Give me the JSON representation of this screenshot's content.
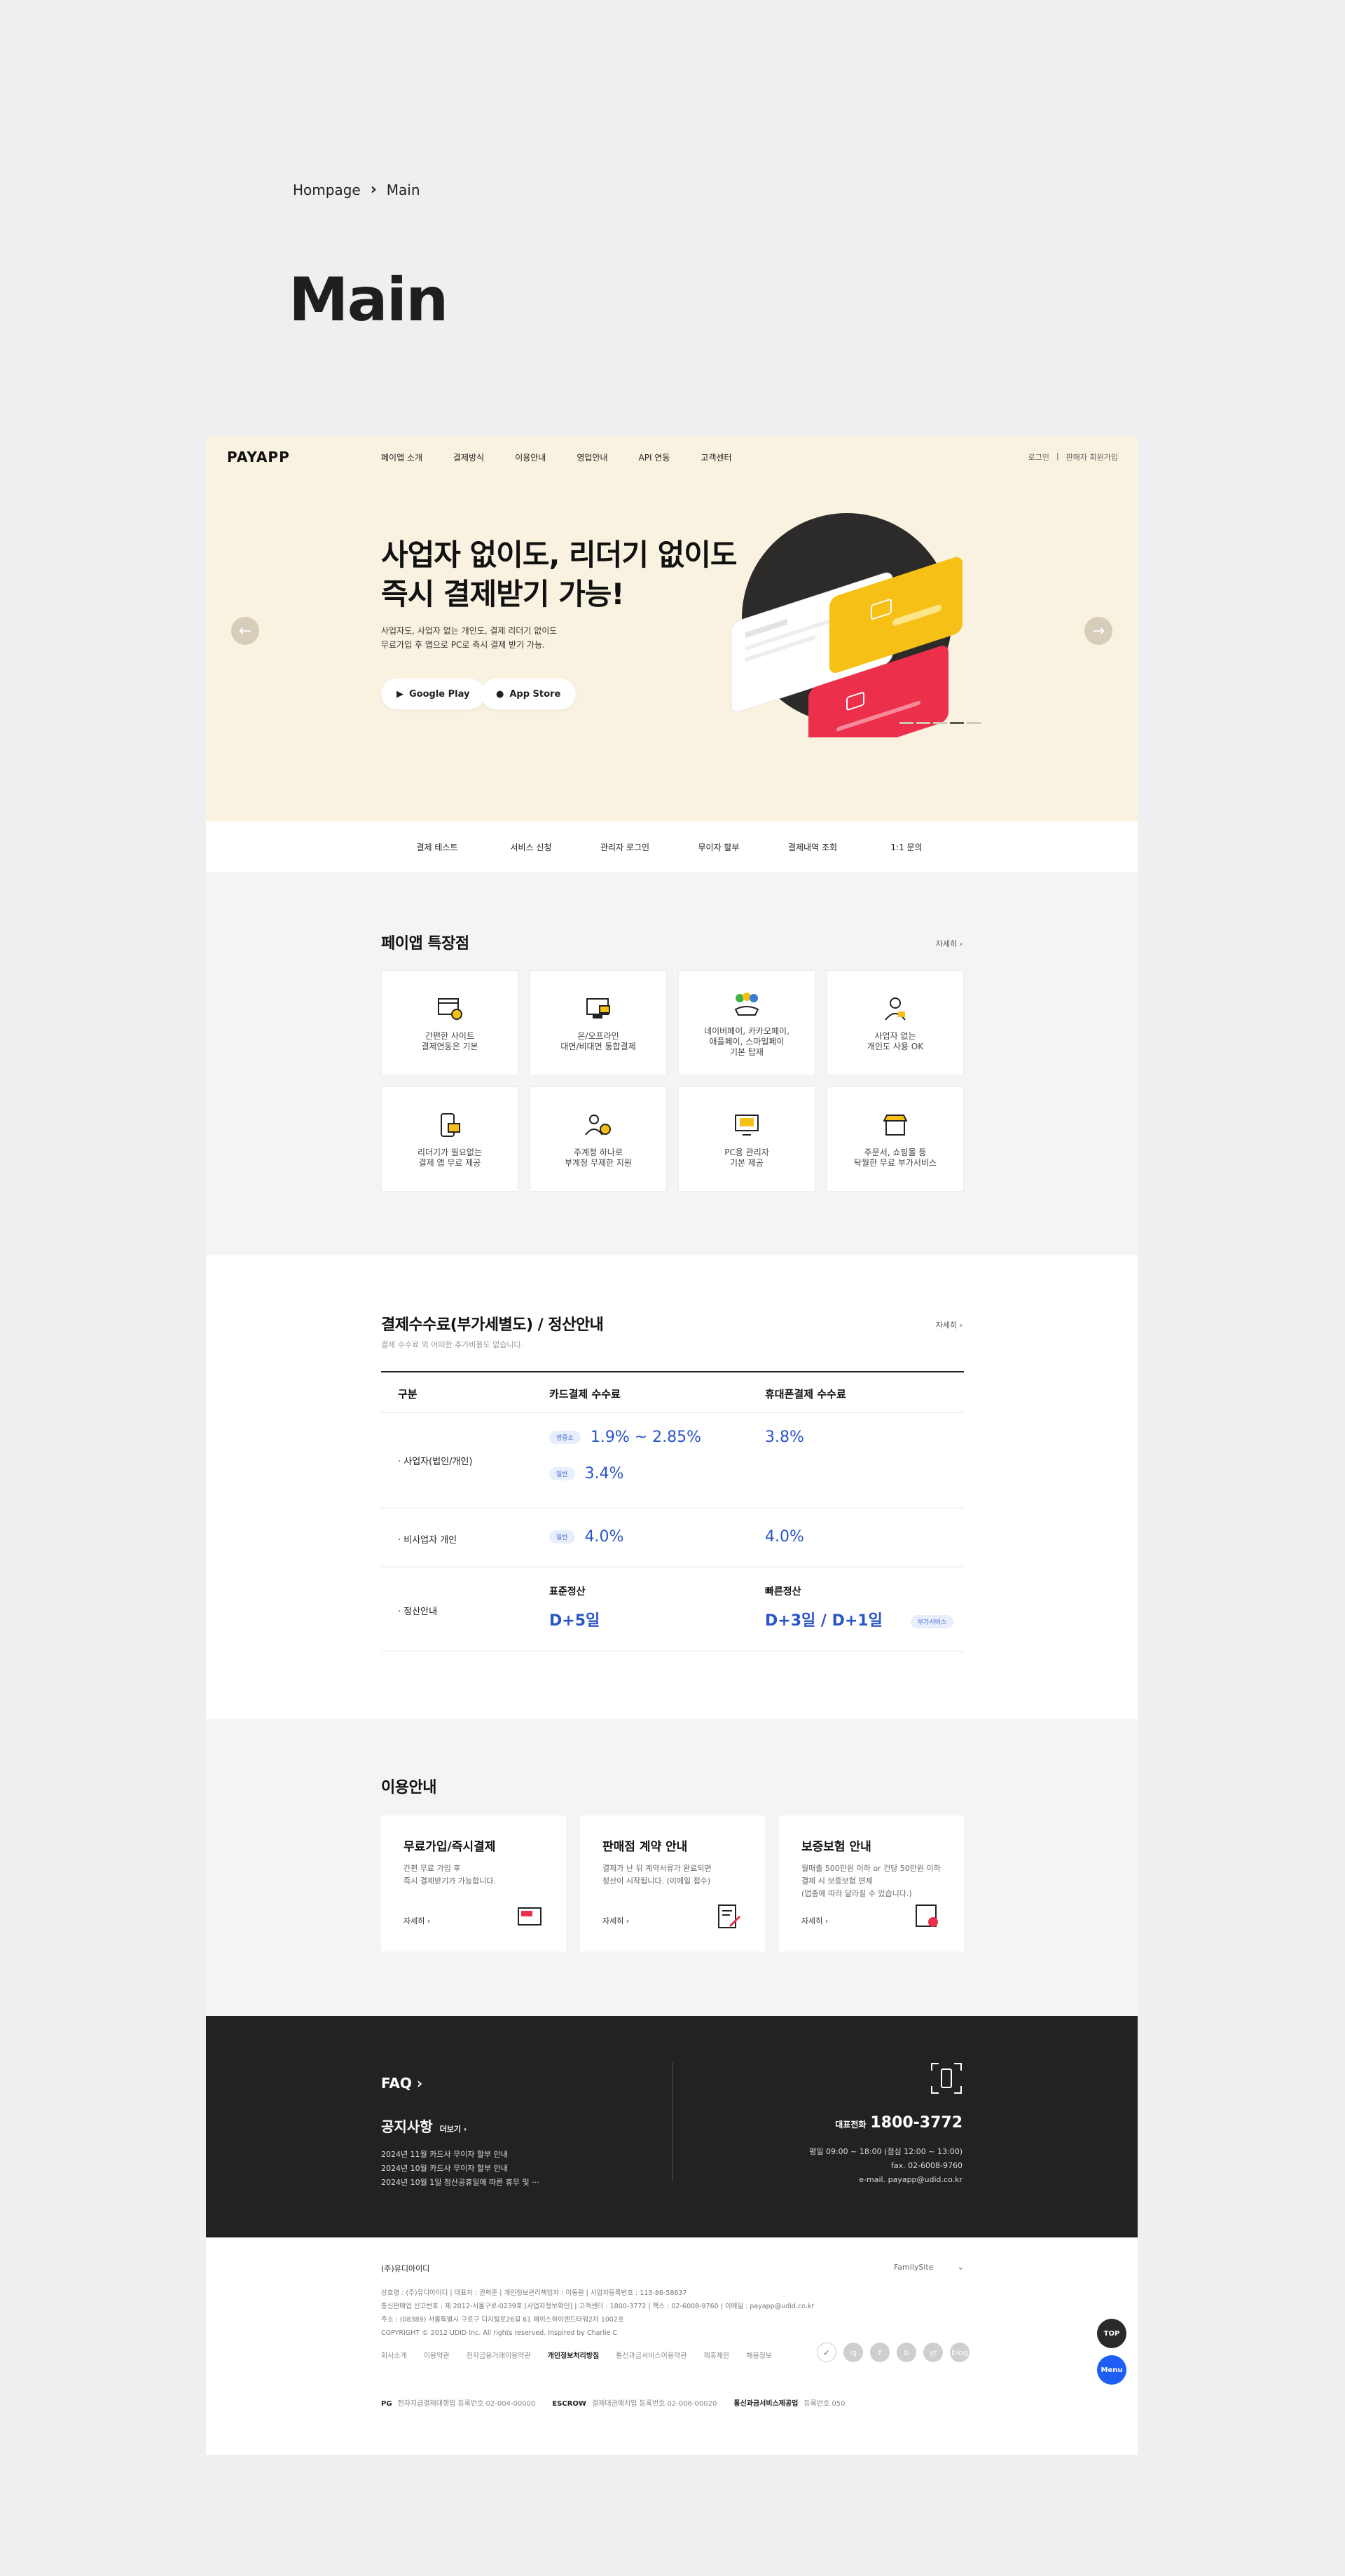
{
  "breadcrumb": {
    "home": "Hompage",
    "current": "Main"
  },
  "page_title": "Main",
  "nav": {
    "logo": "PAYAPP",
    "menu": [
      "페이앱 소개",
      "결제방식",
      "이용안내",
      "영업안내",
      "API 연동",
      "고객센터"
    ],
    "login": "로그인",
    "signup": "판매자 회원가입"
  },
  "hero": {
    "title_line1": "사업자 없이도, 리더기 없이도",
    "title_line2": "즉시 결제받기 가능!",
    "desc_line1": "사업자도, 사업자 없는 개인도, 결제 리더기 없이도",
    "desc_line2": "무료가입 후 앱으로 PC로 즉시 결제 받기 가능.",
    "google_play": "Google Play",
    "app_store": "App Store",
    "prev": "←",
    "next": "→"
  },
  "quick_links": [
    "결제 테스트",
    "서비스 신청",
    "관리자 로그인",
    "무이자 할부",
    "결제내역 조회",
    "1:1 문의"
  ],
  "features": {
    "title": "페이앱 특장점",
    "more": "자세히",
    "items": [
      {
        "label": "간편한 사이트\n결제연동은 기본",
        "icon": "browser-payment-icon"
      },
      {
        "label": "온/오프라인\n대면/비대면 통합결제",
        "icon": "card-terminal-icon"
      },
      {
        "label": "네이버페이, 카카오페이,\n애플페이, 스마일페이\n기본 탑재",
        "icon": "easy-pay-icon"
      },
      {
        "label": "사업자 없는\n개인도 사용 OK",
        "icon": "person-icon"
      },
      {
        "label": "리더기가 필요없는\n결제 앱 무료 제공",
        "icon": "mobile-app-icon"
      },
      {
        "label": "주계정 하나로\n부계정 무제한 지원",
        "icon": "users-check-icon"
      },
      {
        "label": "PC용 관리자\n기본 제공",
        "icon": "monitor-code-icon"
      },
      {
        "label": "주문서, 쇼핑몰 등\n탁월한 무료 부가서비스",
        "icon": "shop-icon"
      }
    ]
  },
  "fees": {
    "title": "결제수수료(부가세별도) / 정산안내",
    "subtitle": "결제 수수료 외 어떠한 추가비용도 없습니다.",
    "more": "자세히",
    "headers": [
      "구분",
      "카드결제 수수료",
      "휴대폰결제 수수료"
    ],
    "rows": {
      "business": {
        "label": "사업자(법인/개인)",
        "tag_special": "영중소",
        "card_special": "1.9% ~ 2.85%",
        "tag_general": "일반",
        "card_general": "3.4%",
        "mobile": "3.8%"
      },
      "individual": {
        "label": "비사업자 개인",
        "tag_general": "일반",
        "card": "4.0%",
        "mobile": "4.0%"
      },
      "settlement": {
        "label": "정산안내",
        "standard_title": "표준정산",
        "standard_value": "D+5일",
        "fast_title": "빠른정산",
        "fast_value": "D+3일 / D+1일",
        "fast_tag": "부가서비스"
      }
    }
  },
  "guide": {
    "title": "이용안내",
    "cards": [
      {
        "title": "무료가입/즉시결제",
        "desc": "간편 무료 가입 후\n즉시 결제받기가 가능합니다.",
        "more": "자세히",
        "icon": "free-card-icon"
      },
      {
        "title": "판매점 계약 안내",
        "desc": "결제가 난 뒤 계약서류가 완료되면\n정산이 시작됩니다. (이메일 접수)",
        "more": "자세히",
        "icon": "contract-icon"
      },
      {
        "title": "보증보험 안내",
        "desc": "월매출 500만원 이하 or 건당 50만원 이하\n결제 시 보증보험 면제\n(업종에 따라 달라질 수 있습니다.)",
        "more": "자세히",
        "icon": "certificate-icon"
      }
    ]
  },
  "dark_footer": {
    "faq": "FAQ",
    "notice": "공지사항",
    "notice_more": "더보기",
    "notices": [
      "2024년 11월 카드사 무이자 할부 안내",
      "2024년 10월 카드사 무이자 할부 안내",
      "2024년 10월 1일 정산공휴일에 따른 휴무 및 ···"
    ],
    "tel_label": "대표전화",
    "tel": "1800-3772",
    "hours": "평일 09:00 ~ 18:00 (점심 12:00 ~ 13:00)",
    "fax": "fax. 02-6008-9760",
    "email": "e-mail. payapp@udid.co.kr"
  },
  "footer": {
    "company": "(주)유디아이디",
    "family_site": "FamilySite",
    "info_lines": [
      "상호명 : (주)유디아이디   |   대표자 : 권혁준   |   개인정보관리책임자 : 이동원   |   사업자등록번호 : 113-86-58637",
      "통신판매업 신고번호 : 제 2012-서울구로-0239호 [사업자정보확인]   |   고객센터 : 1800-3772   |   팩스 : 02-6008-9760   |   이메일 : payapp@udid.co.kr",
      "주소 : (08389) 서울특별시 구로구 디지털로26길 61 에이스하이엔드타워2차 1002호",
      "COPYRIGHT © 2012 UDID Inc. All rights reserved. Inspired by Charlie C"
    ],
    "links": [
      "회사소개",
      "이용약관",
      "전자금융거래이용약관",
      "개인정보처리방침",
      "통신과금서비스이용약관",
      "제휴제안",
      "채용정보"
    ],
    "bold_link": "개인정보처리방침",
    "socials": [
      "ig",
      "f",
      "b",
      "yt",
      "blog"
    ],
    "certs": [
      {
        "k": "PG",
        "v": "전자지급결제대행업 등록번호 02-004-00000"
      },
      {
        "k": "ESCROW",
        "v": "결제대금예치업 등록번호 02-006-00020"
      },
      {
        "k": "통신과금서비스제공업",
        "v": "등록번호 050"
      }
    ],
    "top": "TOP",
    "menu": "Menu"
  },
  "colors": {
    "hero_bg": "#faf2e1",
    "accent": "#2a55c8",
    "dark": "#222222",
    "menu_fab": "#1e5ef5"
  }
}
